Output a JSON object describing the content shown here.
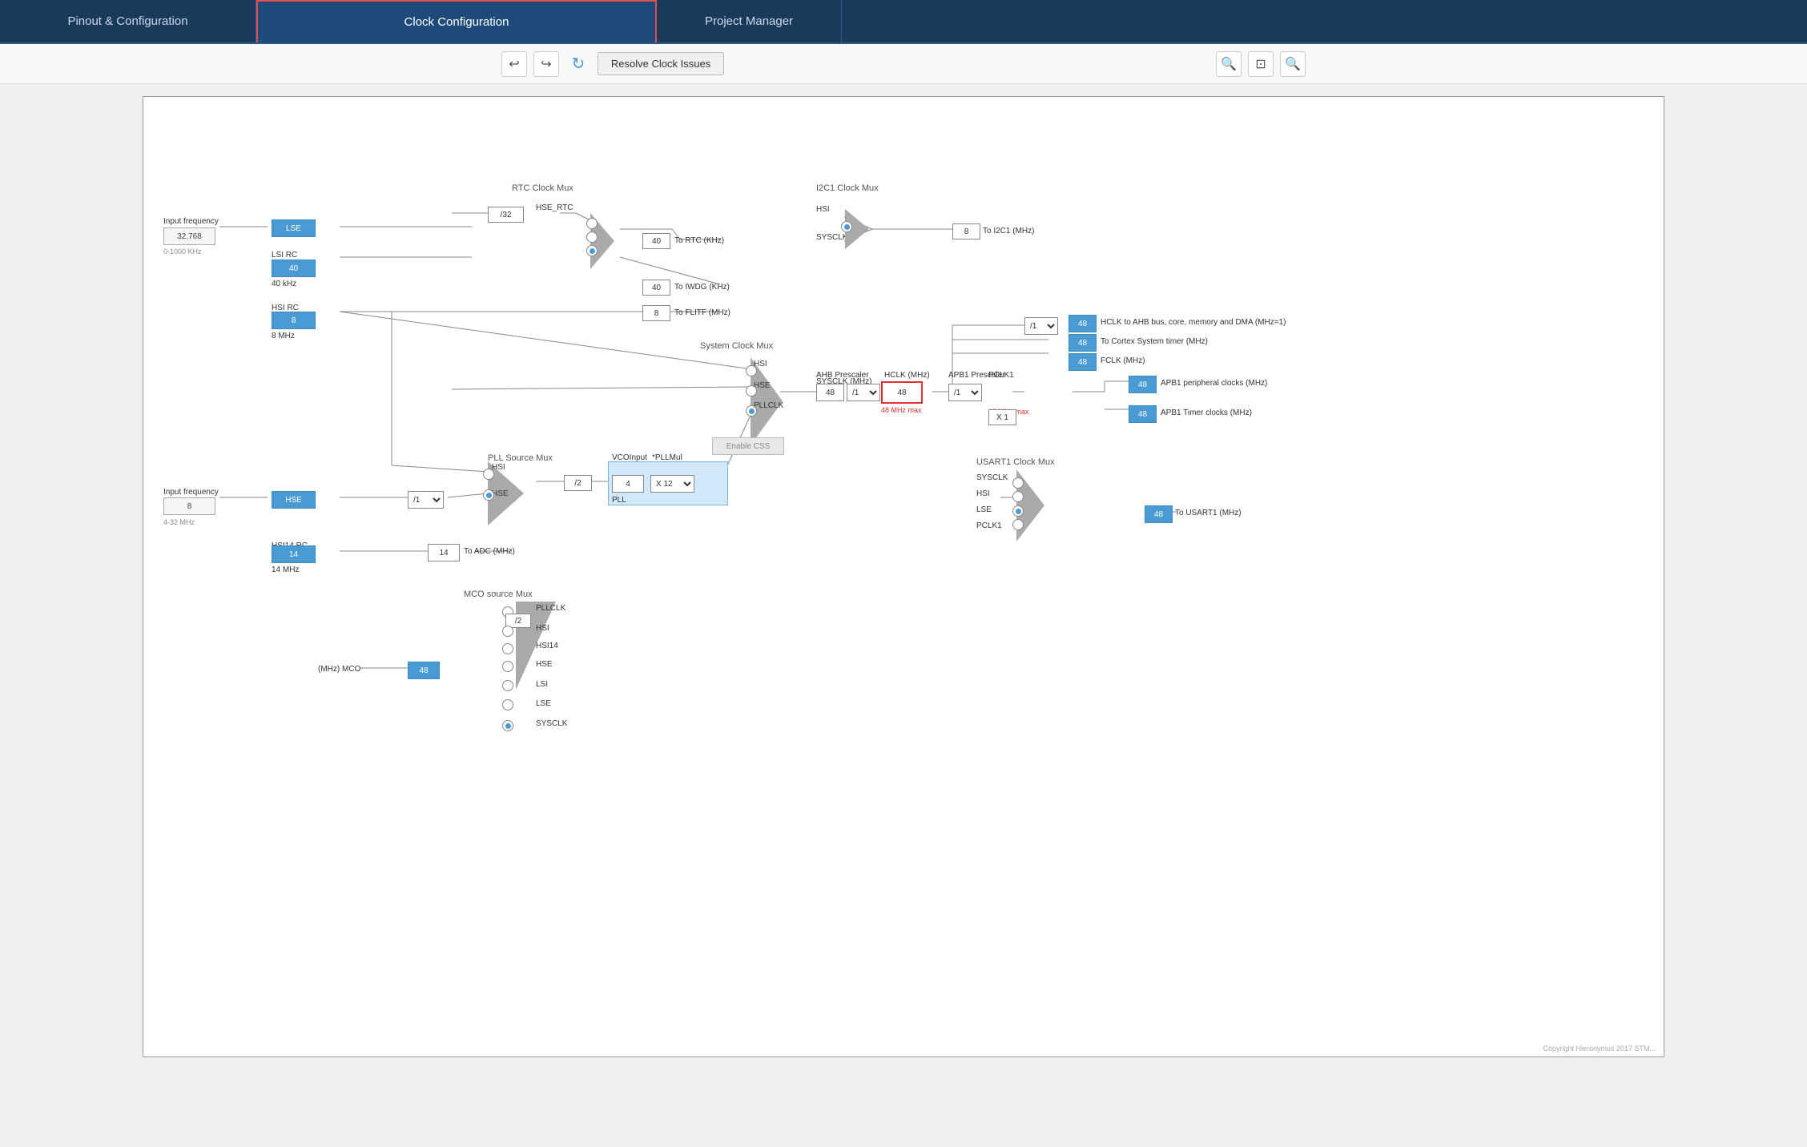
{
  "nav": {
    "items": [
      {
        "label": "Pinout & Configuration",
        "active": false
      },
      {
        "label": "Clock Configuration",
        "active": true
      },
      {
        "label": "Project Manager",
        "active": false
      },
      {
        "label": "",
        "active": false
      }
    ]
  },
  "toolbar": {
    "undo_label": "↩",
    "redo_label": "↪",
    "refresh_label": "↻",
    "resolve_label": "Resolve Clock Issues",
    "zoom_in_label": "🔍",
    "fit_label": "⊡",
    "zoom_out_label": "🔍"
  },
  "diagram": {
    "rtc_mux_label": "RTC Clock Mux",
    "i2c1_mux_label": "I2C1 Clock Mux",
    "pll_source_label": "PLL Source Mux",
    "system_clock_label": "System Clock Mux",
    "usart1_mux_label": "USART1 Clock Mux",
    "mco_source_label": "MCO source Mux",
    "input_freq1_label": "Input frequency",
    "input_freq1_value": "32.768",
    "input_freq1_range": "0-1000 KHz",
    "input_freq2_label": "Input frequency",
    "input_freq2_value": "8",
    "input_freq2_range": "4-32 MHz",
    "lse_label": "LSE",
    "lsi_rc_label": "LSI RC",
    "lsi_value": "40",
    "lsi_freq": "40 kHz",
    "hsi_rc_label": "HSI RC",
    "hsi_value": "8",
    "hsi_freq": "8 MHz",
    "hsi14_rc_label": "HSI14 RC",
    "hsi14_value": "14",
    "hsi14_freq": "14 MHz",
    "hse_label": "HSE",
    "hse_div32": "/32",
    "hse_rtc_label": "HSE_RTC",
    "rtc_out_label": "To RTC (KHz)",
    "rtc_val": "40",
    "iwdg_out_label": "To IWDG (KHz)",
    "iwdg_val": "40",
    "flitf_out_label": "To FLITF (MHz)",
    "flitf_val": "8",
    "i2c1_out_label": "To I2C1 (MHz)",
    "i2c1_val": "8",
    "sysclk_label": "SYSCLK (MHz)",
    "ahb_prescaler_label": "AHB Prescaler",
    "ahb_val": "48",
    "ahb_div": "/1",
    "hclk_label": "HCLK (MHz)",
    "hclk_val": "48",
    "hclk_max": "48 MHz max",
    "apb1_prescaler_label": "APB1 Prescaler",
    "apb1_div": "/1",
    "pclk1_label": "PCLK1",
    "pclk1_max": "48 MHz max",
    "hclk_ahb_label": "HCLK to AHB bus, core, memory and DMA (MHz=1)",
    "hclk_ahb_val": "48",
    "cortex_timer_label": "To Cortex System timer (MHz)",
    "cortex_timer_val": "48",
    "fclk_label": "FCLK (MHz)",
    "fclk_val": "48",
    "apb1_periph_label": "APB1 peripheral clocks (MHz)",
    "apb1_periph_val": "48",
    "apb1_timer_label": "APB1 Timer clocks (MHz)",
    "apb1_timer_val": "48",
    "x1_label": "X 1",
    "pll_vco_label": "VCOInput",
    "pll_mul_label": "*PLLMul",
    "pll_vco_val": "4",
    "pll_mul_val": "X 12",
    "pll_label": "PLL",
    "pll_div2_label": "/2",
    "hsi_pll": "HSI",
    "hse_pll": "HSE",
    "enable_css_label": "Enable CSS",
    "usart1_out_label": "To USART1 (MHz)",
    "usart1_val": "48",
    "mco_out_label": "(MHz) MCO",
    "mco_val": "48",
    "mco_div2": "/2",
    "mco_options": [
      "PLLCLK",
      "HSI",
      "HSI14",
      "HSE",
      "LSI",
      "LSE",
      "SYSCLK"
    ],
    "hsi_label": "HSI",
    "hse_label2": "HSE",
    "pllclk_label": "PLLCLK",
    "sysclk_mux_hsi": "HSI",
    "sysclk_mux_hse": "HSE",
    "sysclk_mux_pllclk": "PLLCLK",
    "usart1_sysclk": "SYSCLK",
    "usart1_hsi": "HSI",
    "usart1_lse": "LSE",
    "usart1_pclk1": "PCLK1"
  }
}
